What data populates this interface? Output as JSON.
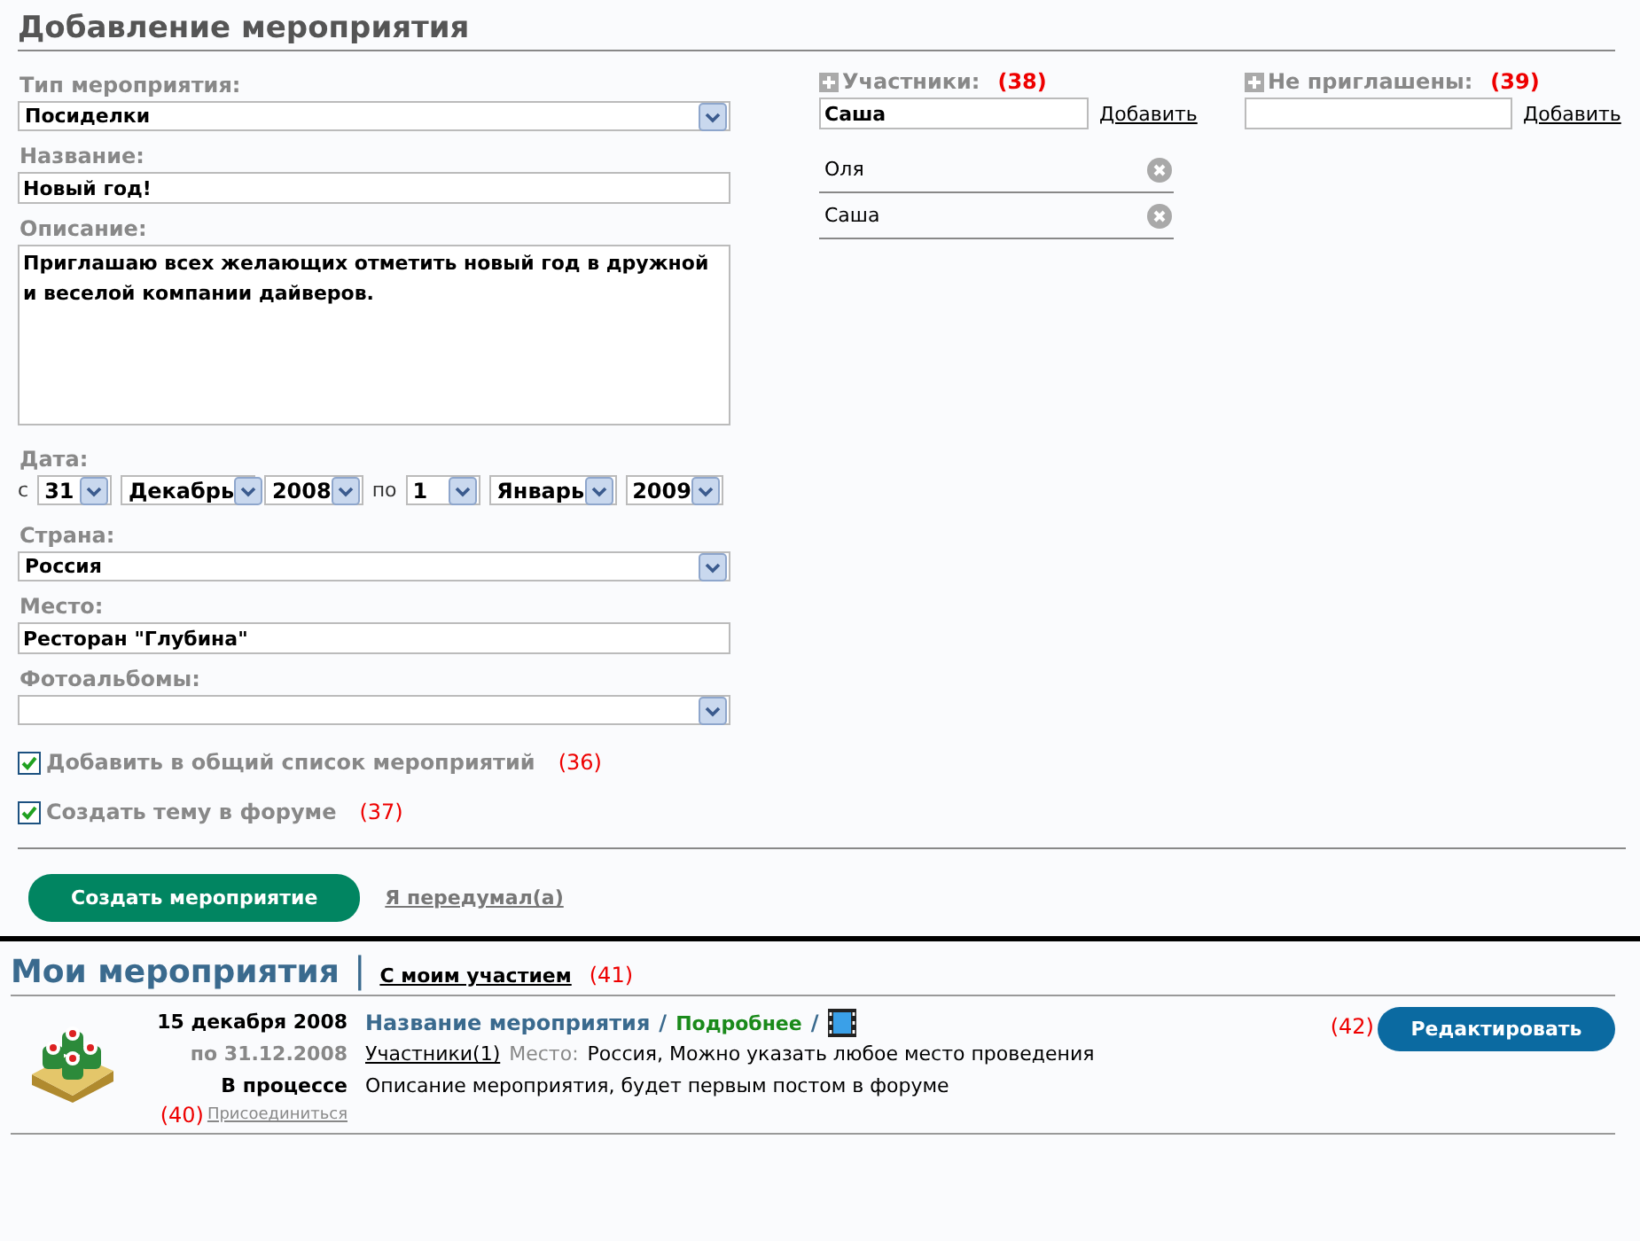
{
  "title": "Добавление мероприятия",
  "form": {
    "type": {
      "label": "Тип мероприятия:",
      "value": "Посиделки"
    },
    "name": {
      "label": "Название:",
      "value": "Новый год!"
    },
    "description": {
      "label": "Описание:",
      "value": "Приглашаю всех желающих отметить новый год в дружной и веселой компании дайверов."
    },
    "date": {
      "label": "Дата:",
      "from_prefix": "с",
      "from": [
        "31",
        "Декабрь",
        "2008"
      ],
      "to_prefix": "по",
      "to": [
        "1",
        "Январь",
        "2009"
      ]
    },
    "country": {
      "label": "Страна:",
      "value": "Россия"
    },
    "place": {
      "label": "Место:",
      "value": "Ресторан \"Глубина\""
    },
    "albums": {
      "label": "Фотоальбомы:"
    },
    "options": [
      {
        "label": "Добавить в общий список мероприятий",
        "checked": true,
        "annotation": "(36)"
      },
      {
        "label": "Создать тему в форуме",
        "checked": true,
        "annotation": "(37)"
      }
    ],
    "submit": "Создать мероприятие",
    "cancel": "Я передумал(а)"
  },
  "participants": {
    "label": "Участники:",
    "annotation": "(38)",
    "input": "Саша",
    "add": "Добавить",
    "items": [
      "Оля",
      "Саша"
    ]
  },
  "not_invited": {
    "label": "Не приглашены:",
    "annotation": "(39)",
    "add": "Добавить"
  },
  "my_events": {
    "title": "Мои мероприятия",
    "separator": "|",
    "tab": "С моим участием",
    "annotation": "(41)",
    "events": [
      {
        "date": "15 декабря 2008",
        "until": "по 31.12.2008",
        "status": "В процессе",
        "annotation": "(40)",
        "join": "Присоединиться",
        "name": "Название мероприятия",
        "separators": [
          "/",
          "/"
        ],
        "more": "Подробнее",
        "participants": "Участники(1)",
        "place_label": "Место:",
        "place": "Россия, Можно указать любое место проведения",
        "description": "Описание мероприятия, будет первым постом в форуме",
        "edit_annotation": "(42)",
        "edit": "Редактировать"
      }
    ]
  }
}
